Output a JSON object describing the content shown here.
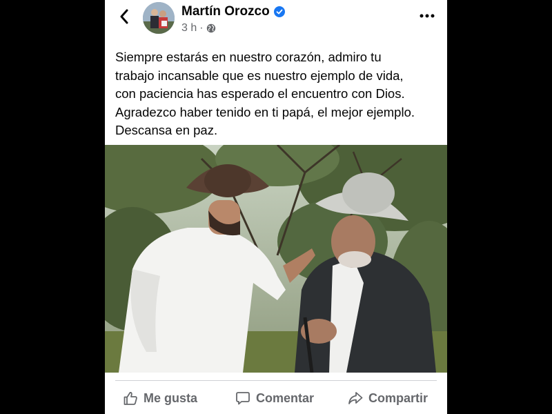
{
  "post": {
    "author": "Martín Orozco",
    "time": "3 h",
    "separator": "·",
    "text_lines": [
      "Siempre estarás en nuestro corazón, admiro tu",
      "trabajo incansable que es nuestro ejemplo de vida,",
      "con paciencia has esperado el encuentro con Dios.",
      "Agradezco haber tenido en ti papá, el mejor ejemplo.",
      "Descansa en paz."
    ]
  },
  "actions": {
    "like": "Me gusta",
    "comment": "Comentar",
    "share": "Compartir"
  },
  "icons": {
    "back": "chevron-left-icon",
    "verified": "verified-badge-icon",
    "privacy": "globe-icon",
    "more": "more-horizontal-icon",
    "like": "thumbs-up-icon",
    "comment": "comment-icon",
    "share": "share-arrow-icon"
  },
  "colors": {
    "verified": "#1877f2",
    "text": "#050505",
    "secondary": "#65676b"
  }
}
